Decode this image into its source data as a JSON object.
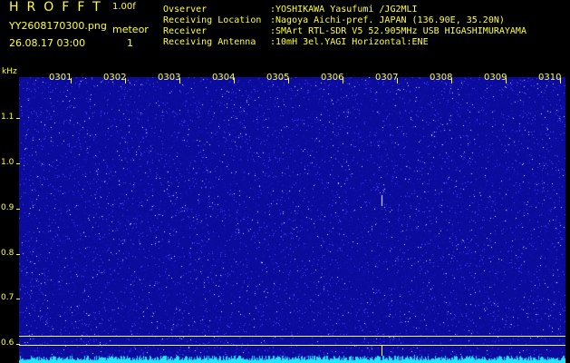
{
  "header": {
    "app_title": "HROFFT",
    "version": "1.00f",
    "filename": "YY2608170300.png",
    "detection_label": "meteor",
    "datetime": "26.08.17 03:00",
    "detection_count": "1"
  },
  "station": [
    {
      "key": "Ovserver",
      "value": ":YOSHIKAWA Yasufumi /JG2MLI"
    },
    {
      "key": "Receiving Location",
      "value": ":Nagoya Aichi-pref. JAPAN (136.90E, 35.20N)"
    },
    {
      "key": "Receiver",
      "value": ":SMArt RTL-SDR V5 52.905MHz USB HIGASHIMURAYAMA"
    },
    {
      "key": "Receiving Antenna",
      "value": ":10mH 3el.YAGI Horizontal:ENE"
    }
  ],
  "axes": {
    "y_unit": "kHz",
    "y_ticks": [
      "1.1",
      "1.0",
      "0.9",
      "0.8",
      "0.7",
      "0.6"
    ],
    "x_ticks": [
      "0301",
      "0302",
      "0303",
      "0304",
      "0305",
      "0306",
      "0307",
      "0308",
      "0309",
      "0310"
    ]
  },
  "colors": {
    "text": "#ffff3c",
    "background_noise": "#0b0b9c",
    "line": "#e8e8e8",
    "trace": "#22e6ff"
  }
}
